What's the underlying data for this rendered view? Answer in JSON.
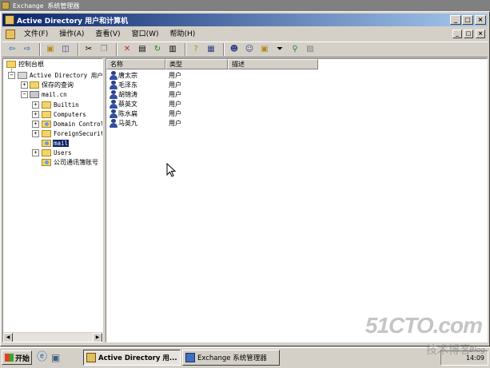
{
  "outer_window": {
    "title": "Exchange 系统管理器"
  },
  "window": {
    "title": "Active Directory 用户和计算机"
  },
  "menu": [
    {
      "label": "文件(F)"
    },
    {
      "label": "操作(A)"
    },
    {
      "label": "查看(V)"
    },
    {
      "label": "窗口(W)"
    },
    {
      "label": "帮助(H)"
    }
  ],
  "tree": {
    "root": "控制台根",
    "ad": "Active Directory 用户",
    "saved_queries": "保存的查询",
    "domain": "mail.cn",
    "builtin": "Builtin",
    "computers": "Computers",
    "domain_controllers": "Domain Controllers",
    "foreign": "ForeignSecurityPrincipals",
    "mail": "mail",
    "users": "Users",
    "contacts": "公司通讯簿账号"
  },
  "list": {
    "columns": [
      "名称",
      "类型",
      "描述"
    ],
    "rows": [
      {
        "name": "唐太宗",
        "type": "用户"
      },
      {
        "name": "毛泽东",
        "type": "用户"
      },
      {
        "name": "胡锦涛",
        "type": "用户"
      },
      {
        "name": "蔡英文",
        "type": "用户"
      },
      {
        "name": "陈水扁",
        "type": "用户"
      },
      {
        "name": "马英九",
        "type": "用户"
      }
    ]
  },
  "taskbar": {
    "start": "开始",
    "tasks": [
      {
        "label": "Active Directory 用..."
      },
      {
        "label": "Exchange 系统管理器"
      }
    ],
    "clock": "14:09"
  },
  "watermark": {
    "main": "51CTO.com",
    "sub": "技术博客",
    "blog": "Blog"
  }
}
